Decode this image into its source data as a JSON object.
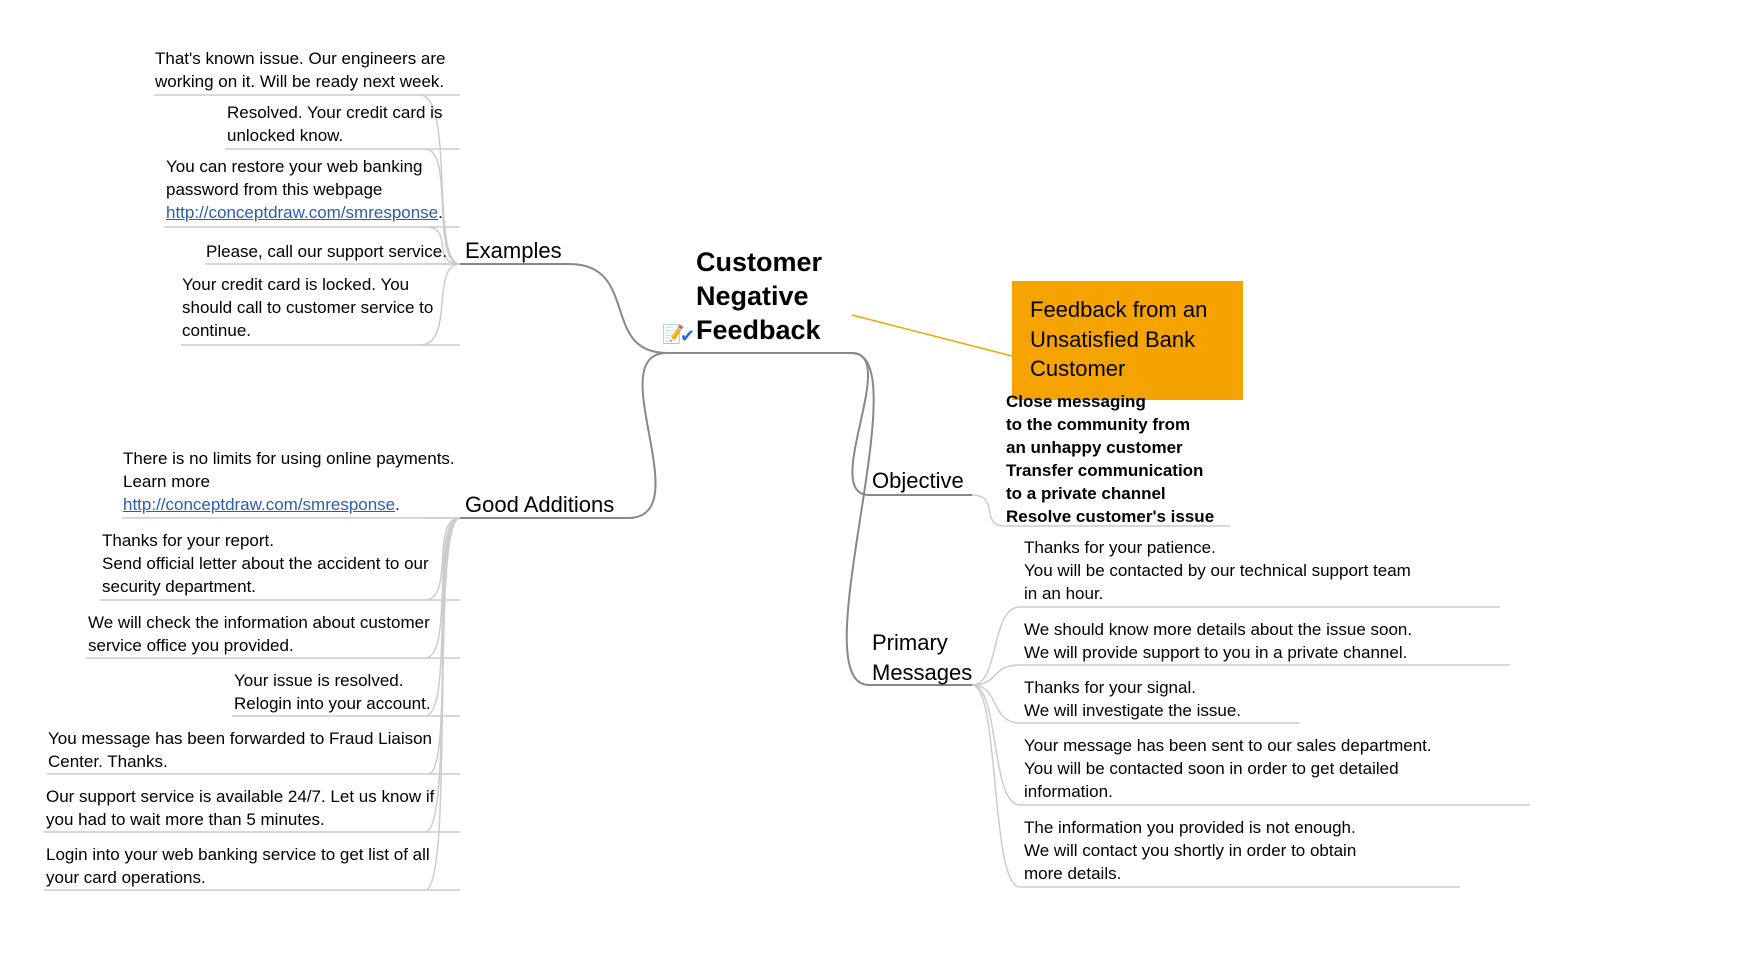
{
  "central": "Customer\nNegative\nFeedback",
  "icons": {
    "note": "📝",
    "check": "✔"
  },
  "callout": "Feedback from an\nUnsatisfied Bank\nCustomer",
  "branches": {
    "examples": {
      "label": "Examples",
      "items": [
        "That's known issue. Our engineers are\nworking on it. Will be ready next week.",
        "Resolved. Your credit card is\nunlocked know.",
        {
          "pre": "You can restore your web banking\npassword from this webpage\n",
          "link": "http://conceptdraw.com/smresponse",
          "post": "."
        },
        "Please, call our support service.",
        "Your credit card is locked. You\nshould call to customer service to\ncontinue."
      ]
    },
    "additions": {
      "label": "Good Additions",
      "items": [
        {
          "pre": "There is no limits for using online payments.\nLearn more\n",
          "link": "http://conceptdraw.com/smresponse",
          "post": "."
        },
        "Thanks for your report.\nSend official letter about the accident to our\nsecurity department.",
        "We will check the information about customer\nservice office you provided.",
        "Your issue is resolved.\nRelogin into your account.",
        "You message has been forwarded to Fraud Liaison\nCenter. Thanks.",
        "Our support service is available 24/7. Let us know if\nyou had to wait more than 5 minutes.",
        "Login into your web banking service to get list of all\nyour card operations."
      ]
    },
    "objective": {
      "label": "Objective",
      "text": "Close messaging\nto the community from\nan unhappy customer\nTransfer communication\nto a private channel\nResolve customer's issue"
    },
    "primary": {
      "label": "Primary\nMessages",
      "items": [
        "Thanks for your patience.\nYou will be contacted by our technical support team\nin an hour.",
        "We should know more details about the issue soon.\nWe will provide support to you in a private channel.",
        "Thanks for your signal.\nWe will investigate the issue.",
        "Your message has been sent to our sales department.\nYou will be contacted soon in order to get detailed\ninformation.",
        "The information you provided is not enough.\nWe will contact you shortly in order to obtain\nmore details."
      ]
    }
  }
}
